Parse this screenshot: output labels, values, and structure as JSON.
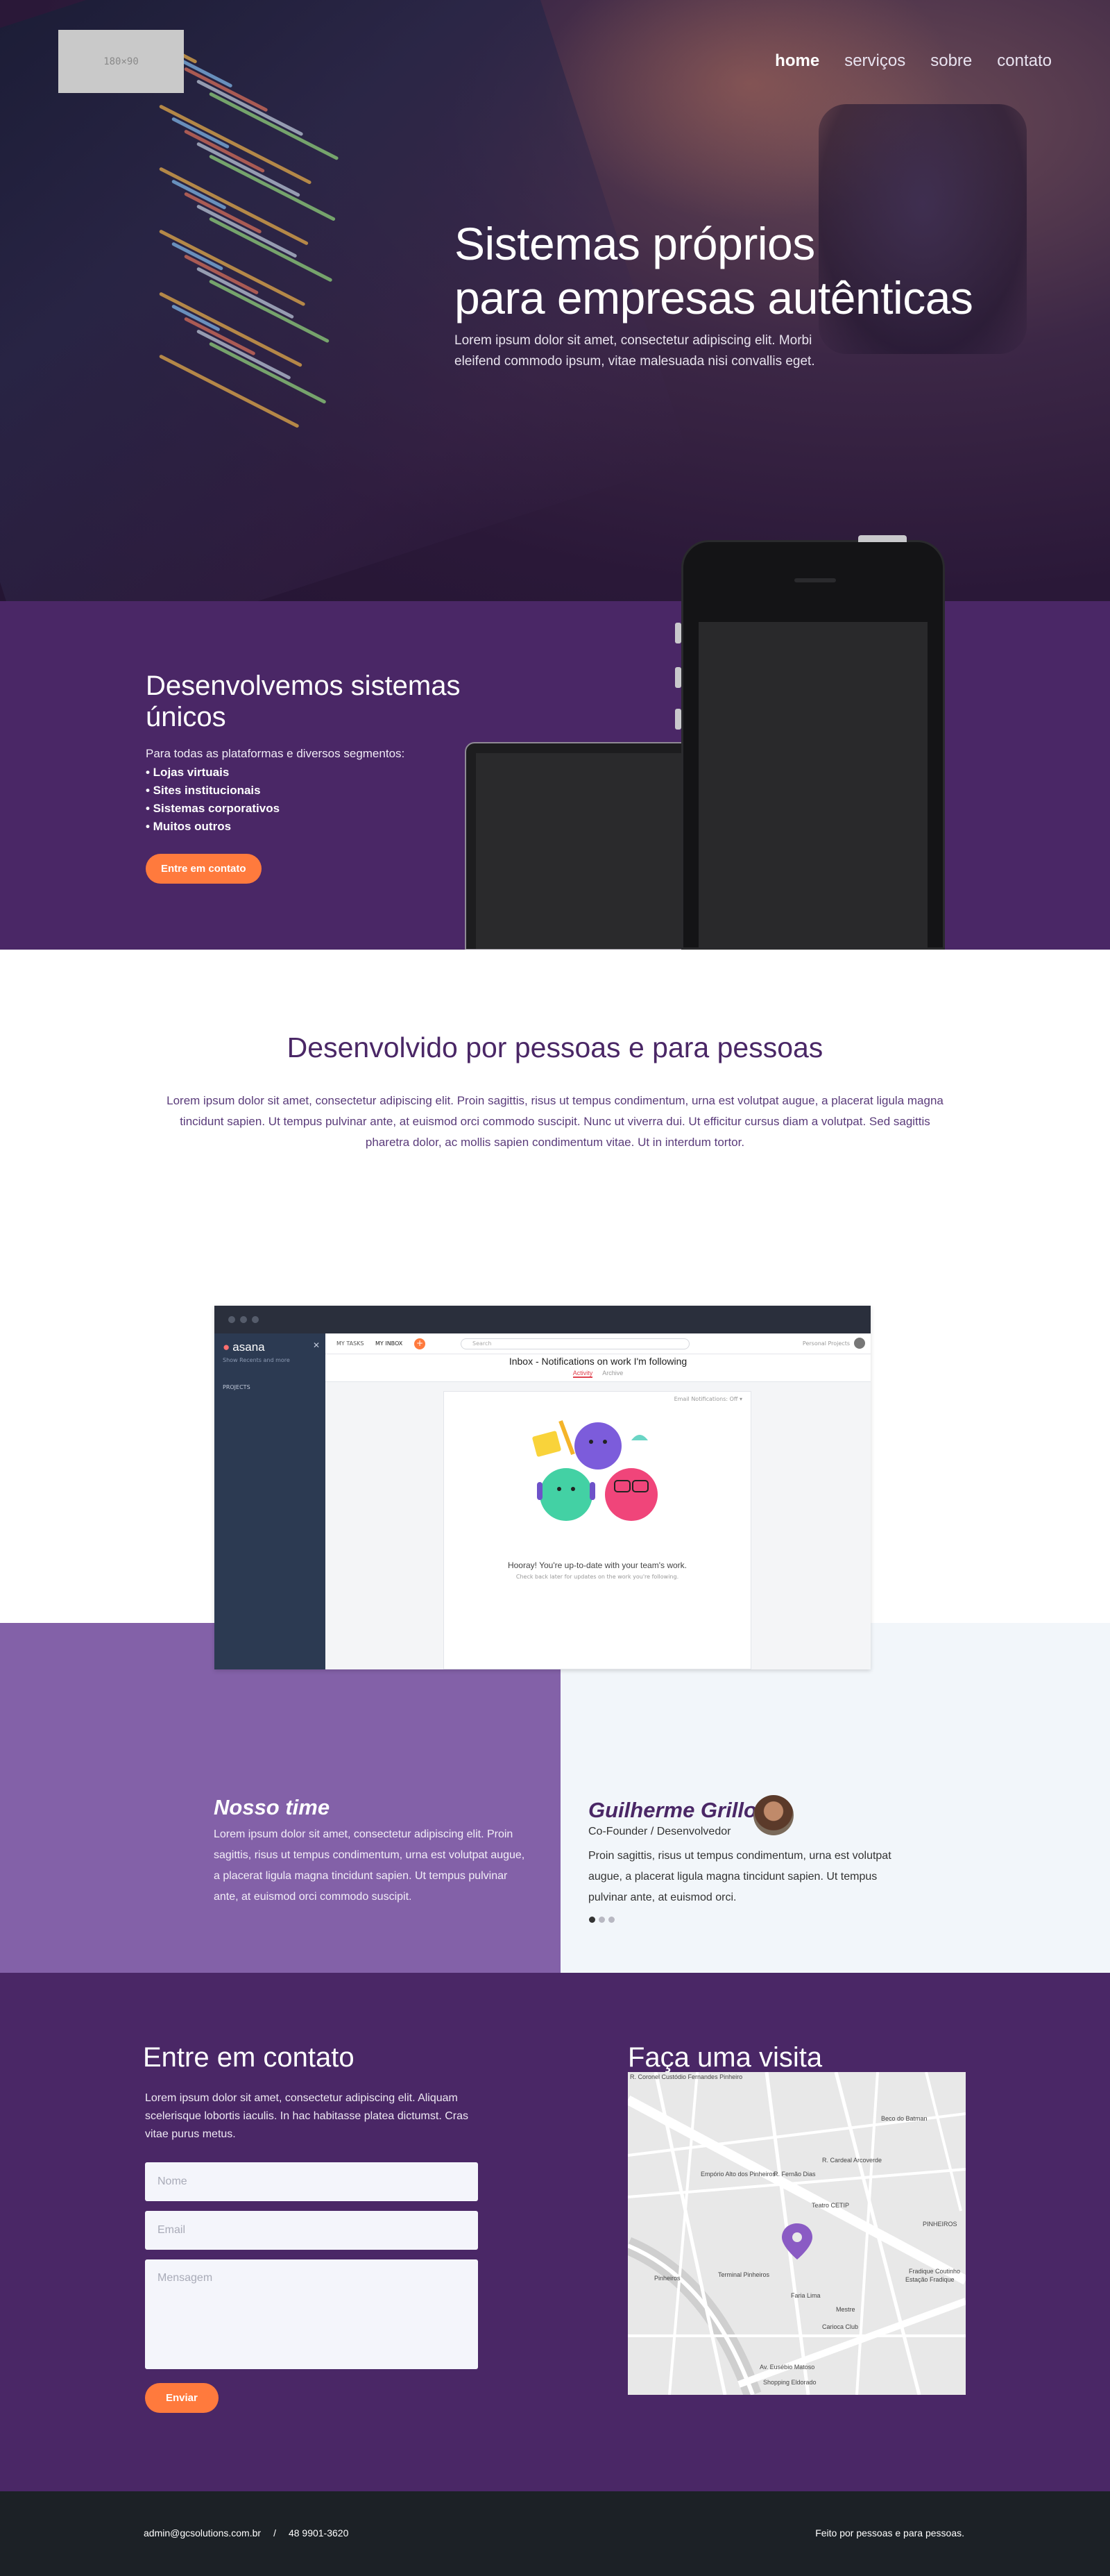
{
  "header": {
    "logo_text": "180×90",
    "nav": [
      {
        "label": "home",
        "active": true
      },
      {
        "label": "serviços",
        "active": false
      },
      {
        "label": "sobre",
        "active": false
      },
      {
        "label": "contato",
        "active": false
      }
    ]
  },
  "hero": {
    "title": "Sistemas próprios\npara empresas autênticas",
    "subtitle": "Lorem ipsum dolor sit amet, consectetur adipiscing elit. Morbi eleifend commodo ipsum, vitae malesuada nisi convallis eget."
  },
  "develop": {
    "title": "Desenvolvemos sistemas únicos",
    "intro": "Para todas as plataformas e diversos segmentos:",
    "items": [
      "• Lojas virtuais",
      "• Sites institucionais",
      "• Sistemas corporativos",
      "• Muitos outros"
    ],
    "button": "Entre em contato",
    "button_color": "#ff7a3d"
  },
  "people": {
    "title": "Desenvolvido por pessoas e para pessoas",
    "text": "Lorem ipsum dolor sit amet, consectetur adipiscing elit. Proin sagittis, risus ut tempus condimentum, urna est volutpat augue, a placerat ligula magna tincidunt sapien. Ut tempus pulvinar ante, at euismod orci commodo suscipit. Nunc ut viverra dui. Ut efficitur cursus diam a volutpat. Sed sagittis pharetra dolor, ac mollis sapien condimentum vitae. Ut in interdum tortor."
  },
  "screenshot": {
    "app_name": "asana",
    "sidebar_sub": "Show Recents and more",
    "projects_label": "PROJECTS",
    "tab_my_tasks": "MY TASKS",
    "tab_my_inbox": "MY INBOX",
    "search_placeholder": "Search",
    "personal_projects": "Personal Projects",
    "inbox_title": "Inbox - Notifications on work I'm following",
    "tab_activity": "Activity",
    "tab_archive": "Archive",
    "filter_label": "Email Notifications: Off ▾",
    "hooray": "Hooray! You're up-to-date with your team's work.",
    "hooray_sub": "Check back later for updates on the work you're following."
  },
  "team": {
    "title": "Nosso time",
    "text": "Lorem ipsum dolor sit amet, consectetur adipiscing elit. Proin sagittis, risus ut tempus condimentum, urna est volutpat augue, a placerat ligula magna tincidunt sapien. Ut tempus pulvinar ante, at euismod orci commodo suscipit."
  },
  "testimonial": {
    "name": "Guilherme Grillo",
    "role": "Co-Founder / Desenvolvedor",
    "text": "Proin sagittis, risus ut tempus condimentum, urna est volutpat augue, a placerat ligula magna tincidunt sapien. Ut tempus pulvinar ante, at euismod orci.",
    "active_dot": 0,
    "dot_count": 3
  },
  "contact": {
    "title": "Entre em contato",
    "text": "Lorem ipsum dolor sit amet, consectetur adipiscing elit. Aliquam scelerisque lobortis iaculis. In hac habitasse platea dictumst. Cras vitae purus metus.",
    "name_placeholder": "Nome",
    "email_placeholder": "Email",
    "message_placeholder": "Mensagem",
    "send_button": "Enviar"
  },
  "visit": {
    "title": "Faça uma visita",
    "map_labels": [
      "Teatro CETIP",
      "Terminal Pinheiros",
      "Faria Lima",
      "Mestre",
      "Carioca Club",
      "PINHEIROS",
      "Fradique Coutinho",
      "Beco do Batman",
      "Empório Alto dos Pinheiros",
      "Av. Eusébio Matoso",
      "Shopping Eldorado",
      "Pinheiros",
      "R. Cardeal Arcoverde",
      "R. Fernão Dias",
      "Estação Fradique",
      "R. Coronel Custódio Fernandes Pinheiro"
    ]
  },
  "footer": {
    "email": "admin@gcsolutions.com.br",
    "separator": "/",
    "phone": "48 9901-3620",
    "tagline": "Feito por pessoas e para pessoas."
  }
}
